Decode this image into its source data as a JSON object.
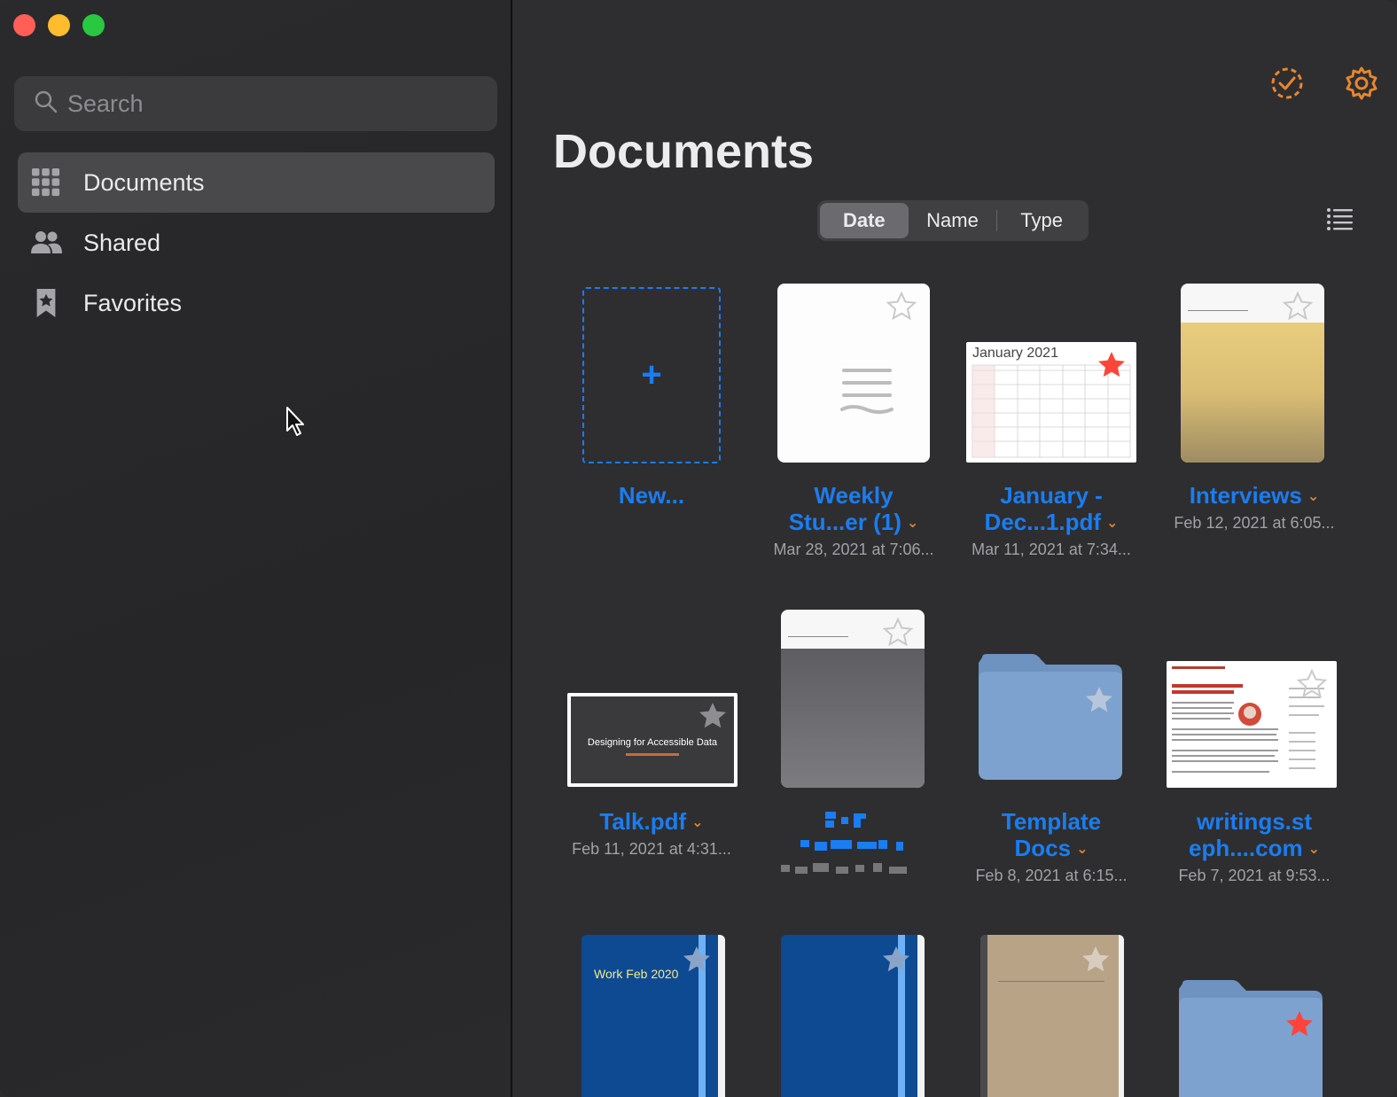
{
  "window": {
    "controls": [
      "close",
      "minimize",
      "zoom"
    ]
  },
  "sidebar": {
    "search_placeholder": "Search",
    "items": [
      {
        "label": "Documents",
        "icon": "grid-icon",
        "active": true
      },
      {
        "label": "Shared",
        "icon": "people-icon",
        "active": false
      },
      {
        "label": "Favorites",
        "icon": "bookmark-star-icon",
        "active": false
      }
    ]
  },
  "main": {
    "title": "Documents",
    "sort": {
      "options": [
        "Date",
        "Name",
        "Type"
      ],
      "selected": "Date"
    },
    "items": [
      {
        "name": "New...",
        "date": ""
      },
      {
        "name_lines": [
          "Weekly",
          "Stu...er (1)"
        ],
        "date": "Mar 28, 2021 at 7:06..."
      },
      {
        "name_lines": [
          "January -",
          "Dec...1.pdf"
        ],
        "date": "Mar 11, 2021 at 7:34...",
        "thumb_title": "January 2021"
      },
      {
        "name": "Interviews",
        "date": "Feb 12, 2021 at 6:05..."
      },
      {
        "name": "Talk.pdf",
        "date": "Feb 11, 2021 at 4:31...",
        "thumb_title": "Designing for Accessible Data"
      },
      {
        "name_lines": [
          "Template",
          "Docs"
        ],
        "date": "Feb 8, 2021 at 6:15..."
      },
      {
        "name_lines": [
          "writings.st",
          "eph....com"
        ],
        "date": "Feb 7, 2021 at 9:53..."
      },
      {
        "thumb_title": "Work Feb 2020"
      }
    ]
  },
  "colors": {
    "accent": "#1a7df2",
    "orange": "#e8862e",
    "favorite": "#ff453a"
  }
}
